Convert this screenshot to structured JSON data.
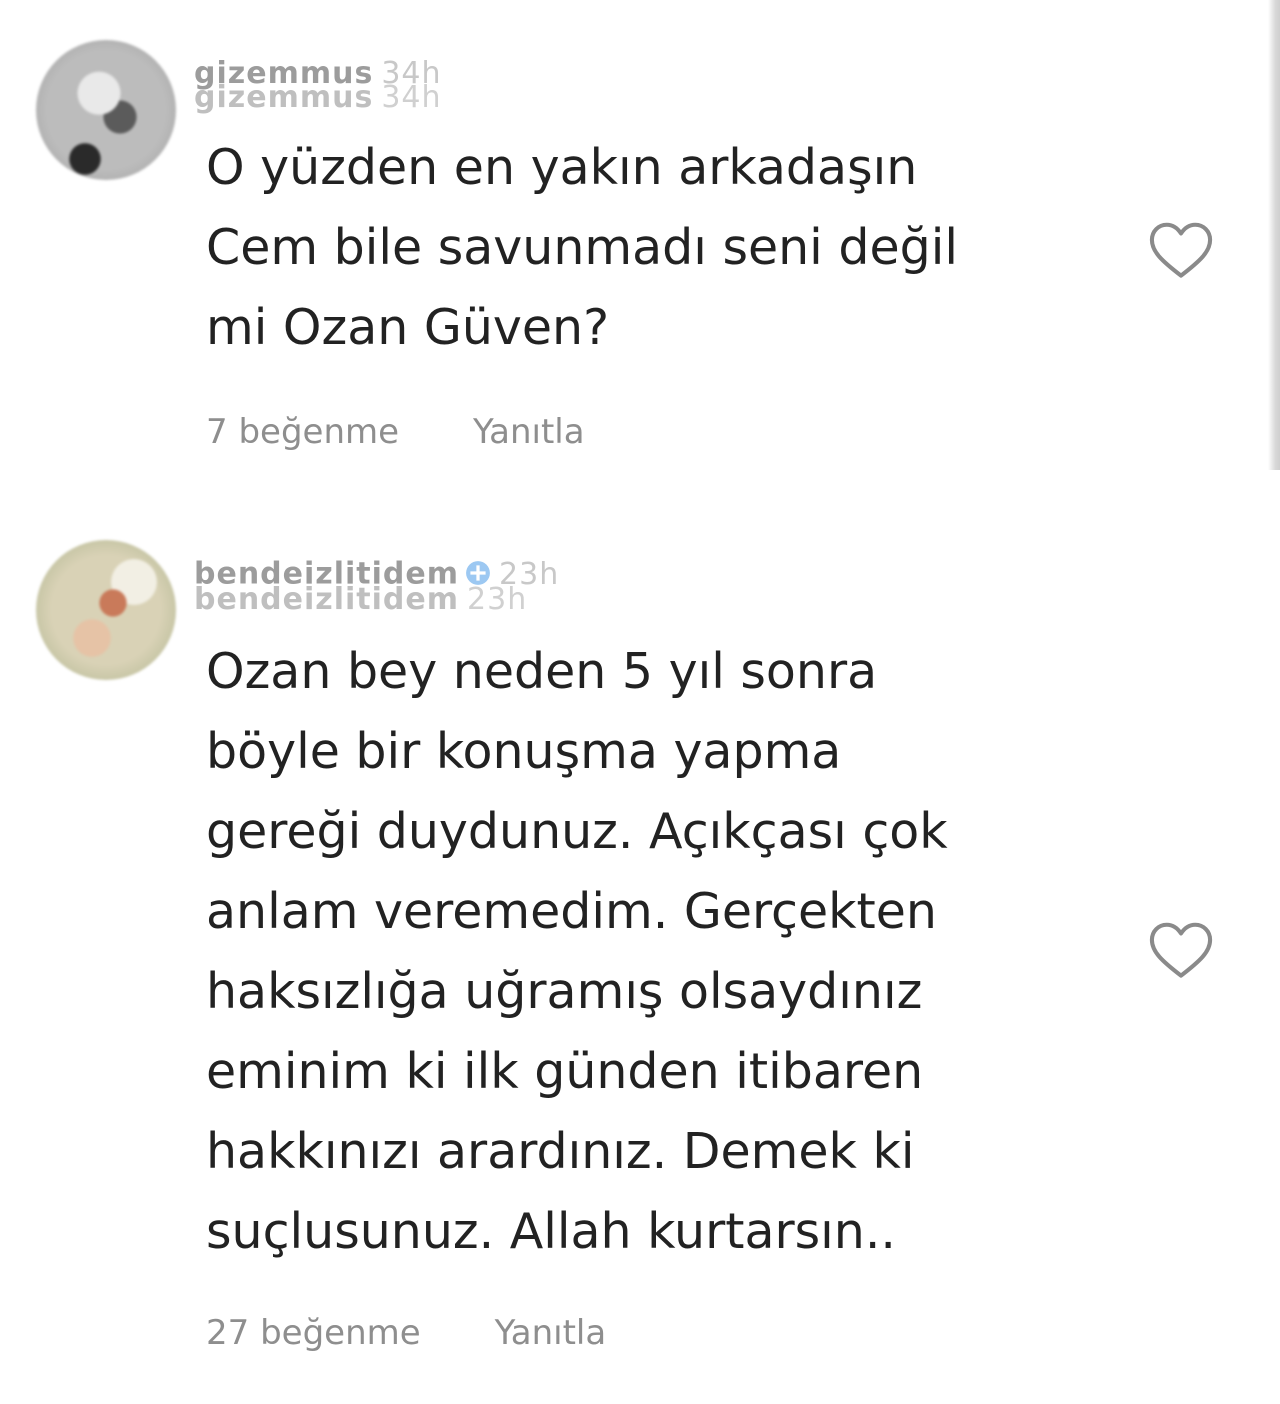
{
  "comments": [
    {
      "username": "gizemmus",
      "time": "34h",
      "text_lines": [
        "O yüzden en yakın arkadaşın",
        "Cem bile savunmadı seni değil",
        "mi Ozan Güven?"
      ],
      "likes": "7 beğenme",
      "reply_label": "Yanıtla",
      "like_icon": "heart-outline-icon"
    },
    {
      "username": "bendeizlitidem",
      "time": "23h",
      "text_lines": [
        "Ozan bey neden 5 yıl sonra",
        "böyle bir konuşma yapma",
        "gereği duydunuz. Açıkçası çok",
        "anlam veremedim. Gerçekten",
        "haksızlığa uğramış olsaydınız",
        "eminim ki ilk günden itibaren",
        "hakkınızı arardınız. Demek ki",
        "suçlusunuz. Allah kurtarsın.."
      ],
      "likes": "27 beğenme",
      "reply_label": "Yanıtla",
      "like_icon": "heart-outline-icon"
    }
  ],
  "colors": {
    "text": "#222222",
    "meta": "#8e8e8e",
    "username": "#9c9c9c",
    "verified_badge": "#3897f0"
  }
}
